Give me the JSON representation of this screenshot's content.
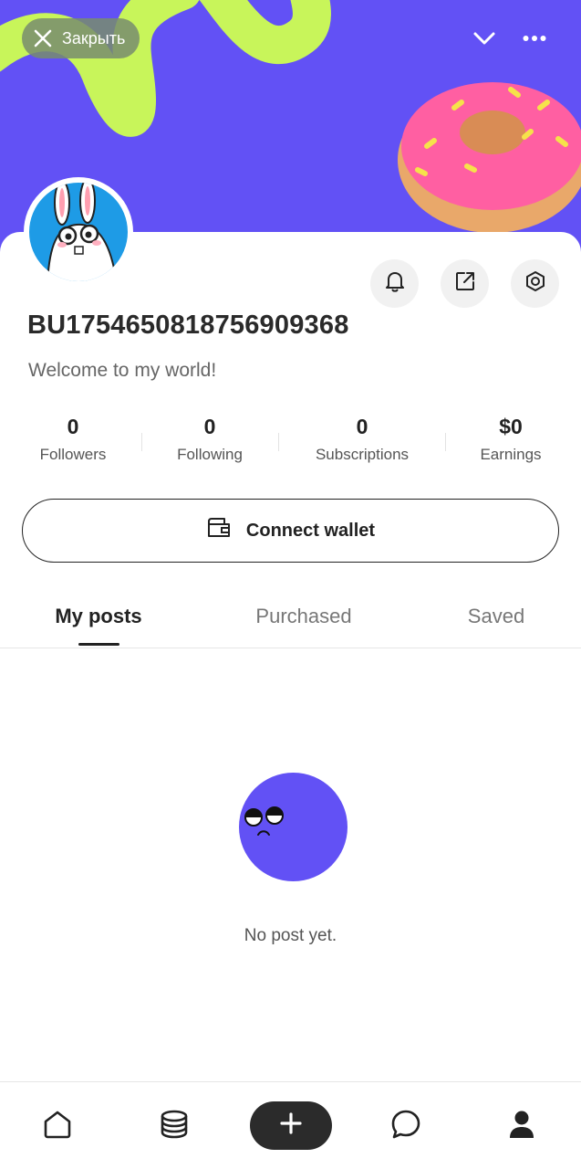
{
  "header": {
    "close_label": "Закрыть"
  },
  "profile": {
    "username": "BU1754650818756909368",
    "bio": "Welcome to my world!"
  },
  "stats": [
    {
      "value": "0",
      "label": "Followers"
    },
    {
      "value": "0",
      "label": "Following"
    },
    {
      "value": "0",
      "label": "Subscriptions"
    },
    {
      "value": "$0",
      "label": "Earnings"
    }
  ],
  "wallet": {
    "label": "Connect wallet"
  },
  "tabs": [
    {
      "label": "My posts",
      "active": true
    },
    {
      "label": "Purchased",
      "active": false
    },
    {
      "label": "Saved",
      "active": false
    }
  ],
  "empty_state": {
    "text": "No post yet."
  },
  "colors": {
    "banner": "#6251f5",
    "accent_green": "#c8f55a",
    "avatar_bg": "#1e9be6",
    "dark": "#2b2b2b"
  },
  "icons": {
    "close": "close-icon",
    "collapse": "chevron-down-icon",
    "more": "more-icon",
    "notifications": "bell-icon",
    "share": "share-icon",
    "settings": "settings-icon",
    "wallet": "wallet-icon",
    "nav": [
      "home-icon",
      "database-icon",
      "plus-icon",
      "chat-icon",
      "profile-icon"
    ]
  }
}
